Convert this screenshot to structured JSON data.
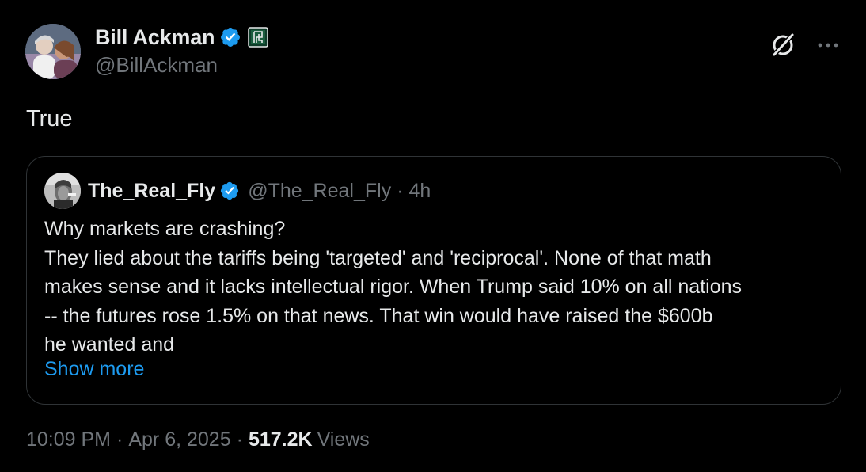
{
  "author": {
    "display_name": "Bill Ackman",
    "handle": "@BillAckman"
  },
  "tweet": {
    "text": "True"
  },
  "quoted": {
    "display_name": "The_Real_Fly",
    "handle": "@The_Real_Fly",
    "separator": "·",
    "time": "4h",
    "lines": [
      "Why markets are crashing?",
      "They lied about the tariffs being 'targeted' and 'reciprocal'. None of that math",
      "makes sense and it lacks intellectual rigor. When Trump said 10% on all nations",
      "-- the futures rose 1.5% on that news. That win would have raised the $600b",
      "he wanted and"
    ],
    "show_more": "Show more"
  },
  "meta": {
    "time": "10:09 PM",
    "separator": "·",
    "date": "Apr 6, 2025",
    "views_count": "517.2K",
    "views_label": "Views"
  },
  "icons": {
    "verified": "verified-badge-icon",
    "affiliate": "affiliate-badge-icon",
    "grok": "grok-icon",
    "more": "more-options-icon"
  },
  "colors": {
    "background": "#000000",
    "text": "#e7e9ea",
    "muted": "#71767b",
    "link": "#1d9bf0",
    "verified": "#1d9bf0",
    "border": "#2f3336"
  }
}
